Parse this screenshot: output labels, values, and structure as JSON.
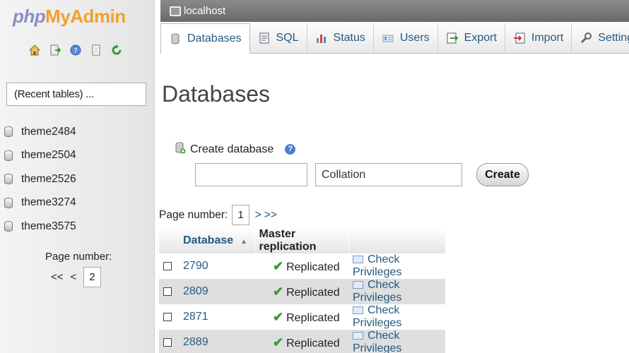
{
  "nav": {
    "logo": {
      "php": "php",
      "my": "My",
      "admin": "Admin"
    },
    "icons": [
      "home-icon",
      "exit-icon",
      "help-icon",
      "docs-icon",
      "reload-icon"
    ],
    "recent_tables": "(Recent tables) ...",
    "databases": [
      "theme2484",
      "theme2504",
      "theme2526",
      "theme3274",
      "theme3575"
    ],
    "page_label": "Page number:",
    "first": "<<",
    "prev": "<",
    "page": "2"
  },
  "server": {
    "name": "localhost"
  },
  "tabs": [
    {
      "label": "Databases",
      "icon": "databases-icon",
      "active": true
    },
    {
      "label": "SQL",
      "icon": "sql-icon"
    },
    {
      "label": "Status",
      "icon": "status-icon"
    },
    {
      "label": "Users",
      "icon": "users-icon"
    },
    {
      "label": "Export",
      "icon": "export-icon"
    },
    {
      "label": "Import",
      "icon": "import-icon"
    },
    {
      "label": "Settings",
      "icon": "settings-icon"
    }
  ],
  "main": {
    "title": "Databases",
    "create_label": "Create database",
    "db_name_value": "",
    "collation_value": "Collation",
    "create_button": "Create",
    "pager": {
      "label": "Page number:",
      "page": "1",
      "next": ">",
      "last": ">>"
    },
    "table": {
      "headers": {
        "database": "Database",
        "replication": "Master replication"
      },
      "rows": [
        {
          "name": "2790",
          "replication": "Replicated",
          "privileges": "Check Privileges"
        },
        {
          "name": "2809",
          "replication": "Replicated",
          "privileges": "Check Privileges"
        },
        {
          "name": "2871",
          "replication": "Replicated",
          "privileges": "Check Privileges"
        },
        {
          "name": "2889",
          "replication": "Replicated",
          "privileges": "Check Privileges"
        }
      ]
    }
  },
  "colors": {
    "link": "#235a81",
    "logo_blue": "#8a8ec8",
    "logo_orange": "#f0a030",
    "check_green": "#3a9a3a"
  }
}
